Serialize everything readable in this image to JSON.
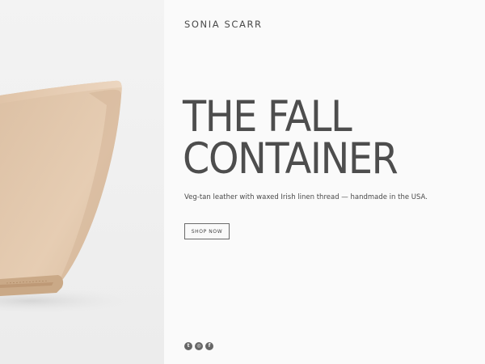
{
  "brand": {
    "name": "SONIA SCARR"
  },
  "hero": {
    "headline_line1": "THE FALL",
    "headline_line2": "CONTAINER",
    "tagline": "Veg-tan leather with waxed Irish linen thread — handmade in the USA.",
    "cta_label": "SHOP NOW"
  },
  "social": {
    "twitter_glyph": "t",
    "instagram_glyph": "◎",
    "facebook_glyph": "f",
    "icons": [
      "twitter-icon",
      "instagram-icon",
      "facebook-icon"
    ]
  },
  "colors": {
    "background": "#fafafa",
    "text": "#4d4d4d",
    "leather": "#e2c8ad"
  }
}
